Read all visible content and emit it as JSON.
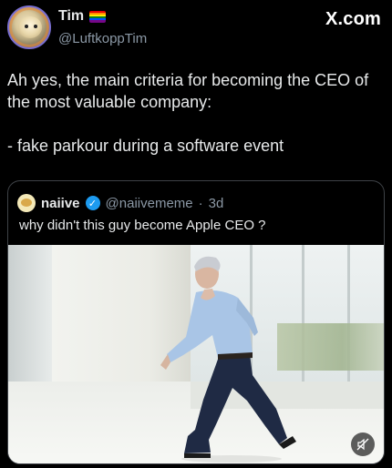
{
  "author": {
    "display_name": "Tim",
    "handle": "@LuftkoppTim",
    "flag_colors": [
      "#e40303",
      "#ff8c00",
      "#ffed00",
      "#008026",
      "#004dff",
      "#750787"
    ]
  },
  "watermark": "X.com",
  "tweet": {
    "line1": "Ah yes, the main criteria for becoming the CEO of the most valuable company:",
    "line2": "- fake parkour during a software event"
  },
  "quoted": {
    "display_name": "naiive",
    "handle": "@naiivememe",
    "separator": "·",
    "age": "3d",
    "text": "why didn't this guy become Apple CEO ?",
    "verified_color": "#1d9bf0"
  },
  "media": {
    "icons": [
      "mute-icon"
    ]
  }
}
